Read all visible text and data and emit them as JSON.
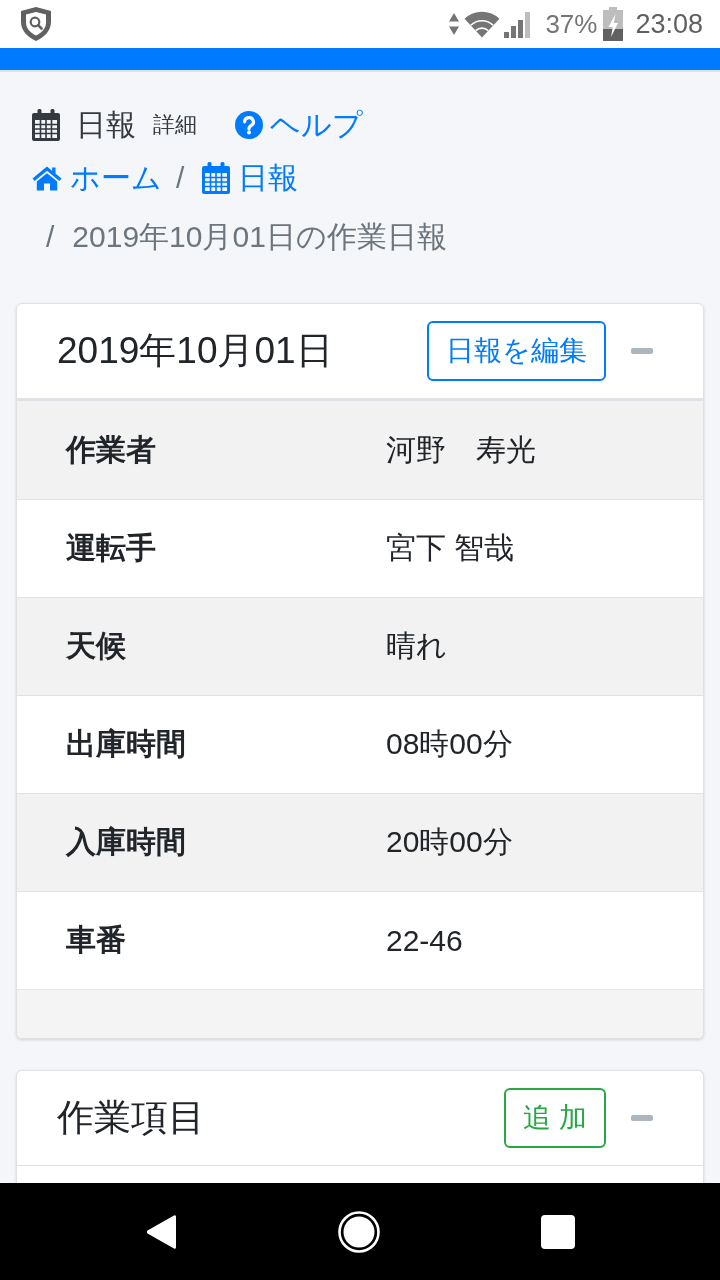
{
  "status_bar": {
    "battery": "37%",
    "time": "23:08"
  },
  "page_header": {
    "title": "日報",
    "subtitle": "詳細",
    "help_link": "ヘルプ"
  },
  "breadcrumb": [
    {
      "kind": "home",
      "label": "ホーム",
      "active": false
    },
    {
      "kind": "section",
      "separator": "/",
      "label": "日報",
      "active": false
    },
    {
      "kind": "page",
      "separator": "/",
      "label": "2019年10月01日の作業日報",
      "active": true
    }
  ],
  "cards": [
    {
      "title": "2019年10月01日",
      "button": {
        "label": "日報を編集",
        "kind": "edit"
      },
      "expanded": true,
      "rows": [
        {
          "label": "作業者",
          "value": "河野　寿光"
        },
        {
          "label": "運転手",
          "value": "宮下 智哉"
        },
        {
          "label": "天候",
          "value": "晴れ"
        },
        {
          "label": "出庫時間",
          "value": "08時00分"
        },
        {
          "label": "入庫時間",
          "value": "20時00分"
        },
        {
          "label": "車番",
          "value": "22-46"
        }
      ]
    },
    {
      "title": "作業項目",
      "button": {
        "label": "追 加",
        "kind": "add"
      },
      "expanded": true
    }
  ]
}
